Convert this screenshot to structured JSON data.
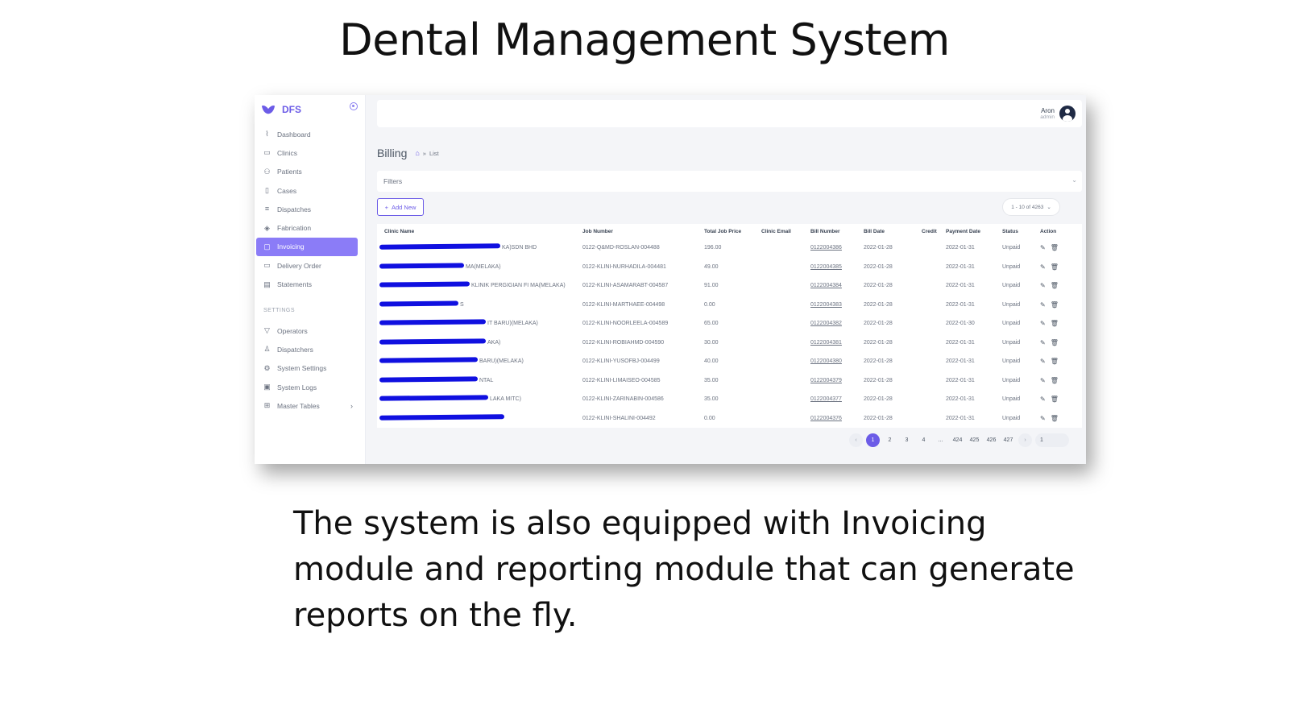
{
  "slide": {
    "title": "Dental Management System",
    "caption": "The system is also equipped with Invoicing module and reporting module that can generate reports on the fly."
  },
  "app": {
    "brand": "DFS",
    "accent_color": "#6c5ce7",
    "user": {
      "name": "Aron",
      "role": "admin"
    }
  },
  "sidebar": {
    "items": [
      {
        "label": "Dashboard",
        "icon": "activity-icon"
      },
      {
        "label": "Clinics",
        "icon": "folder-icon"
      },
      {
        "label": "Patients",
        "icon": "user-plus-icon"
      },
      {
        "label": "Cases",
        "icon": "book-icon"
      },
      {
        "label": "Dispatches",
        "icon": "dispatch-icon"
      },
      {
        "label": "Fabrication",
        "icon": "layers-icon"
      },
      {
        "label": "Invoicing",
        "icon": "clipboard-icon",
        "active": true
      },
      {
        "label": "Delivery Order",
        "icon": "tablet-icon"
      },
      {
        "label": "Statements",
        "icon": "file-text-icon"
      }
    ],
    "settings_label": "SETTINGS",
    "settings_items": [
      {
        "label": "Operators",
        "icon": "filter-icon"
      },
      {
        "label": "Dispatchers",
        "icon": "user-icon"
      },
      {
        "label": "System Settings",
        "icon": "gear-icon"
      },
      {
        "label": "System Logs",
        "icon": "archive-icon"
      },
      {
        "label": "Master Tables",
        "icon": "grid-icon"
      }
    ]
  },
  "page": {
    "title": "Billing",
    "breadcrumb": "List",
    "filters_label": "Filters",
    "add_new_label": "Add New",
    "pager_select": "1 - 10 of 4263"
  },
  "table": {
    "columns": [
      "Clinic Name",
      "Job Number",
      "Total Job Price",
      "Clinic Email",
      "Bill Number",
      "Bill Date",
      "Credit",
      "Payment Date",
      "Status",
      "Action"
    ],
    "rows": [
      {
        "clinic": "KA)SDN BHD",
        "job": "0122-Q&MD-ROSLAN-004488",
        "price": "196.00",
        "email": "",
        "bill": "0122004386",
        "bill_date": "2022-01-28",
        "credit": "",
        "payment_date": "2022-01-31",
        "status": "Unpaid"
      },
      {
        "clinic": "MA(MELAKA)",
        "job": "0122-KLINI-NURHADILA-004481",
        "price": "49.00",
        "email": "",
        "bill": "0122004385",
        "bill_date": "2022-01-28",
        "credit": "",
        "payment_date": "2022-01-31",
        "status": "Unpaid"
      },
      {
        "clinic": "KLINIK PERGIGIAN FI  MA(MELAKA)",
        "job": "0122-KLINI-ASAMARABT-004587",
        "price": "91.00",
        "email": "",
        "bill": "0122004384",
        "bill_date": "2022-01-28",
        "credit": "",
        "payment_date": "2022-01-31",
        "status": "Unpaid"
      },
      {
        "clinic": "S",
        "job": "0122-KLINI-MARTHAEE-004498",
        "price": "0.00",
        "email": "",
        "bill": "0122004383",
        "bill_date": "2022-01-28",
        "credit": "",
        "payment_date": "2022-01-31",
        "status": "Unpaid"
      },
      {
        "clinic": "IT BARU)(MELAKA)",
        "job": "0122-KLINI-NOORLEELA-004589",
        "price": "65.00",
        "email": "",
        "bill": "0122004382",
        "bill_date": "2022-01-28",
        "credit": "",
        "payment_date": "2022-01-30",
        "status": "Unpaid"
      },
      {
        "clinic": "AKA)",
        "job": "0122-KLINI-ROBIAHMD-004590",
        "price": "30.00",
        "email": "",
        "bill": "0122004381",
        "bill_date": "2022-01-28",
        "credit": "",
        "payment_date": "2022-01-31",
        "status": "Unpaid"
      },
      {
        "clinic": "BARU)(MELAKA)",
        "job": "0122-KLINI-YUSOFBJ-004499",
        "price": "40.00",
        "email": "",
        "bill": "0122004380",
        "bill_date": "2022-01-28",
        "credit": "",
        "payment_date": "2022-01-31",
        "status": "Unpaid"
      },
      {
        "clinic": "NTAL",
        "job": "0122-KLINI-LIMAISEO-004585",
        "price": "35.00",
        "email": "",
        "bill": "0122004379",
        "bill_date": "2022-01-28",
        "credit": "",
        "payment_date": "2022-01-31",
        "status": "Unpaid"
      },
      {
        "clinic": "LAKA MITC)",
        "job": "0122-KLINI-ZARINABIN-004586",
        "price": "35.00",
        "email": "",
        "bill": "0122004377",
        "bill_date": "2022-01-28",
        "credit": "",
        "payment_date": "2022-01-31",
        "status": "Unpaid"
      },
      {
        "clinic": "",
        "job": "0122-KLINI-SHALINI-004492",
        "price": "0.00",
        "email": "",
        "bill": "0122004376",
        "bill_date": "2022-01-28",
        "credit": "",
        "payment_date": "2022-01-31",
        "status": "Unpaid"
      }
    ]
  },
  "pagination": {
    "prev": "‹",
    "pages": [
      "1",
      "2",
      "3",
      "4",
      "...",
      "424",
      "425",
      "426",
      "427"
    ],
    "current": "1",
    "next": "›",
    "goto": "1"
  }
}
